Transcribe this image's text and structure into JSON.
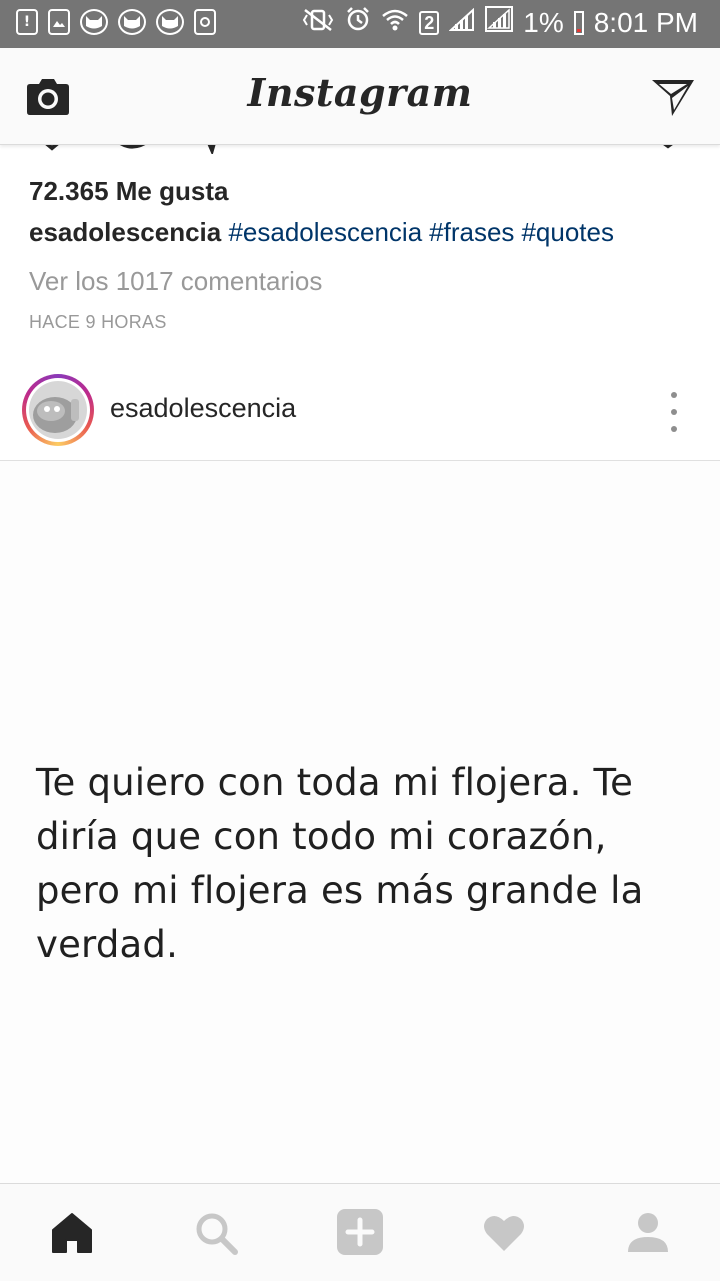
{
  "status_bar": {
    "notification_icons": [
      "battery-alert-icon",
      "image-icon",
      "cat-icon",
      "cat-icon",
      "cat-icon",
      "recycle-icon"
    ],
    "sim_slot": "2",
    "battery_percent": "1%",
    "time": "8:01 PM"
  },
  "header": {
    "logo": "Instagram",
    "icons": [
      "camera-icon",
      "direct-message-icon"
    ]
  },
  "post": {
    "likes": "72.365 Me gusta",
    "caption_user": "esadolescencia",
    "hashtags": [
      "#esadolescencia",
      "#frases",
      "#quotes"
    ],
    "comments_link": "Ver los 1017 comentarios",
    "time_ago": "HACE 9 HORAS"
  },
  "next_post": {
    "username": "esadolescencia",
    "quote": "Te quiero con toda mi flojera. Te diría que con todo mi corazón, pero mi flojera es más grande la verdad."
  },
  "bottom_nav": {
    "items": [
      "home-icon",
      "search-icon",
      "add-icon",
      "heart-icon",
      "profile-icon"
    ],
    "active": "home-icon"
  },
  "colors": {
    "status_bar": "#757575",
    "hashtag": "#003569",
    "muted_text": "#999999",
    "nav_active": "#262626",
    "nav_inactive": "#c7c7c7"
  }
}
